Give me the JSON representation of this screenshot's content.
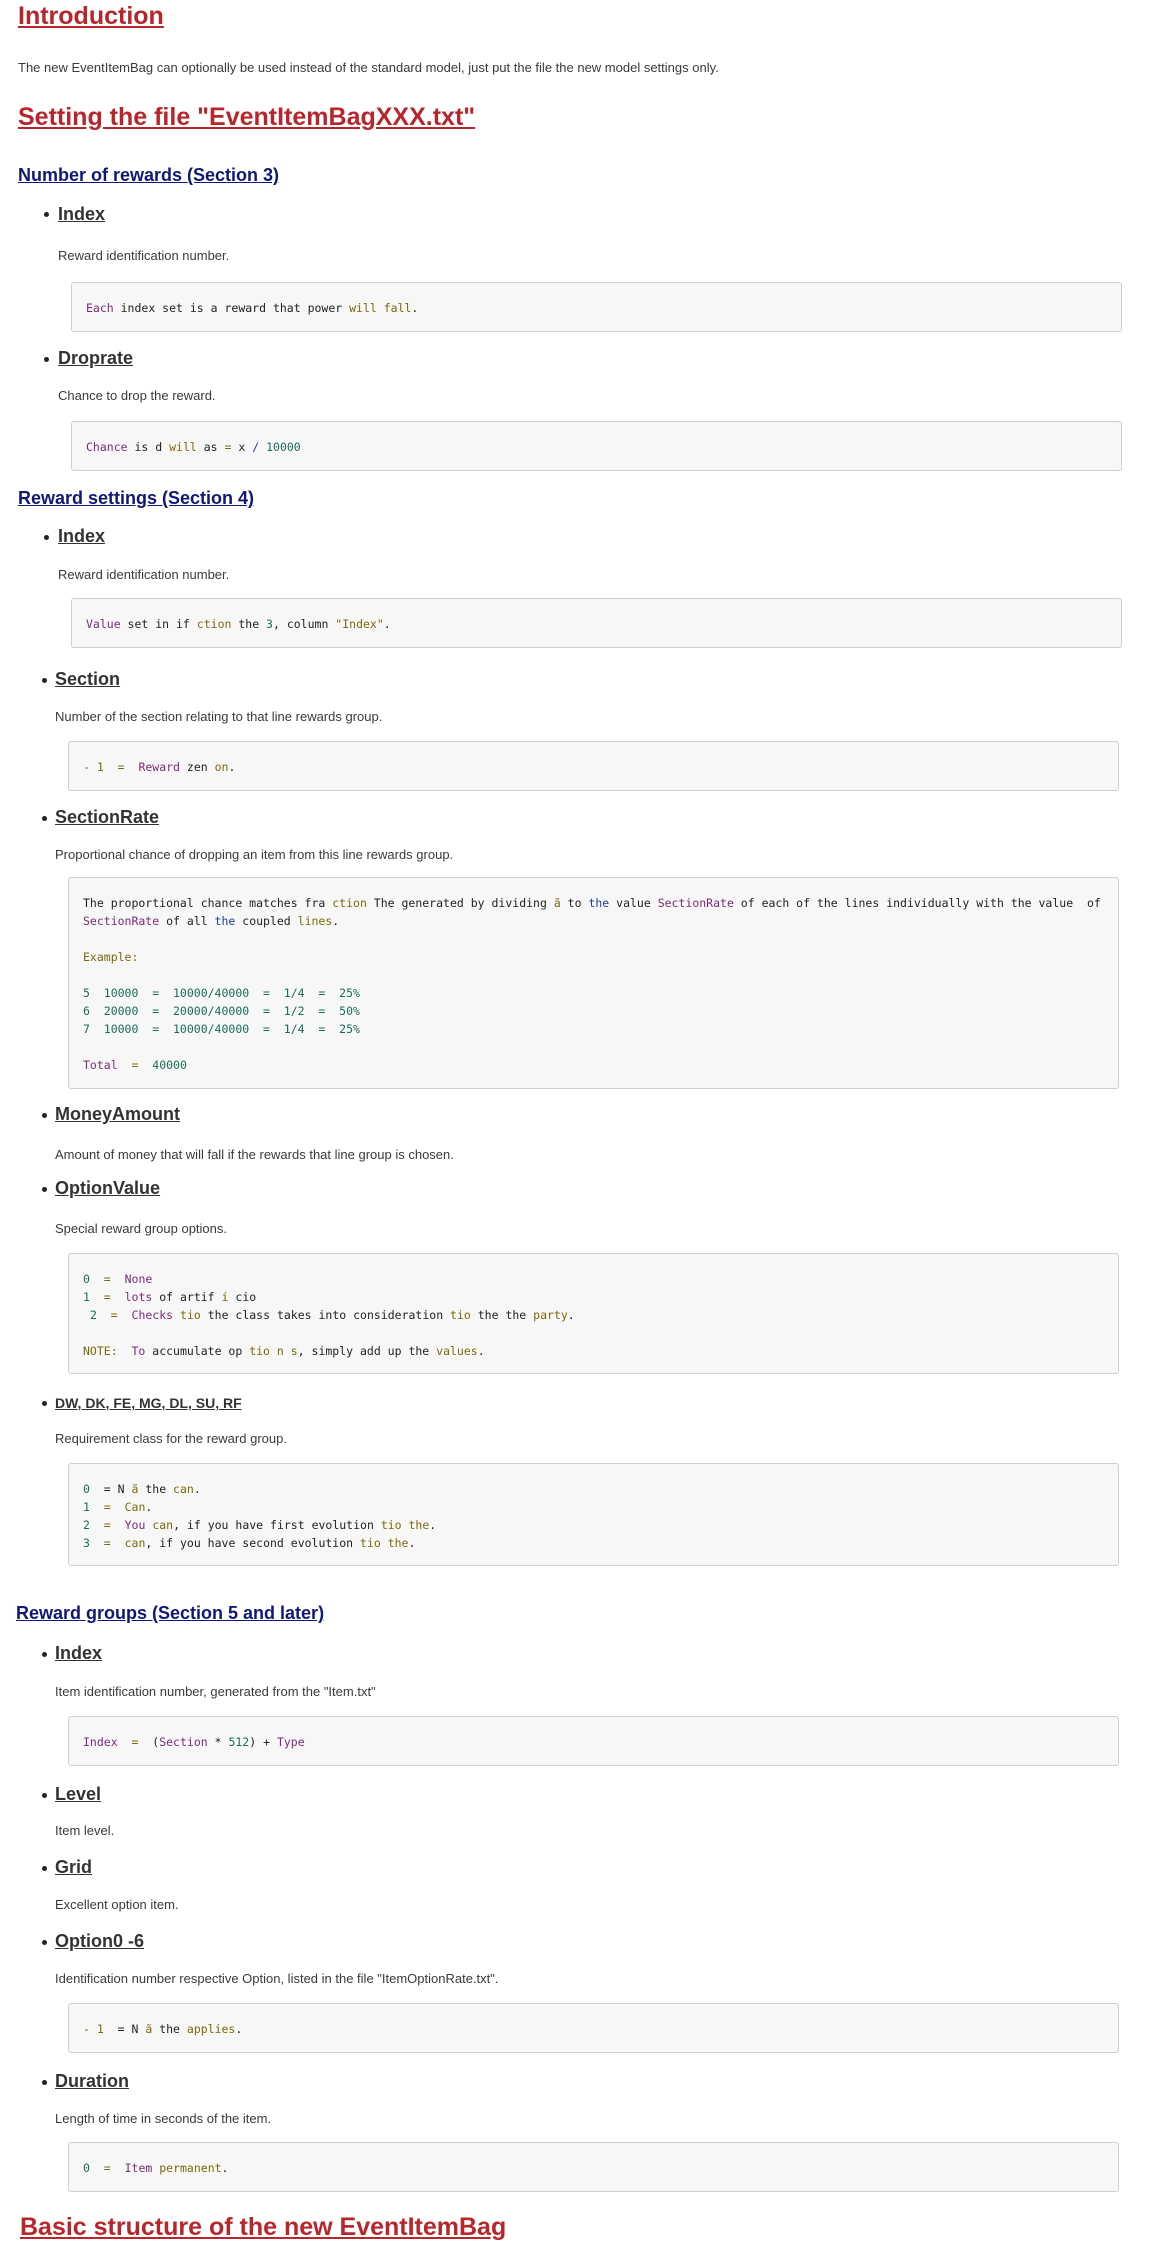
{
  "sections": {
    "introduction": {
      "title": "Introduction",
      "text": "The new EventItemBag can optionally be used instead of the standard model, just put the file the new model settings only."
    },
    "setting_file": {
      "title": "Setting the file \"EventItemBagXXX.txt\""
    },
    "number_of_rewards": {
      "title": "Number of rewards (Section 3)",
      "items": [
        {
          "name": "Index",
          "desc": "Reward identification number.",
          "code": [
            "Each index set is a reward that power will fall."
          ]
        },
        {
          "name": "Droprate",
          "desc": "Chance to drop the reward.",
          "code": [
            "Chance is d will as = x / 10000"
          ]
        }
      ]
    },
    "reward_settings": {
      "title": "Reward settings (Section 4)",
      "items": [
        {
          "name": "Index",
          "desc": "Reward identification number.",
          "code": [
            "Value set in if ction the 3, column \"Index\"."
          ]
        },
        {
          "name": "Section",
          "desc": "Number of the section relating to that line rewards group.",
          "code": [
            "- 1  =  Reward zen on."
          ]
        },
        {
          "name": "SectionRate",
          "desc": "Proportional chance of dropping an item from  this line rewards group.",
          "code": [
            "The proportional chance matches fra ction The generated by dividing ã to the value SectionRate of each of the lines individually with the value  of SectionRate of all the coupled lines.",
            "",
            "Example:",
            "",
            "5  10000  =  10000/40000  =  1/4  =  25%",
            "6  20000  =  20000/40000  =  1/2  =  50%",
            "7  10000  =  10000/40000  =  1/4  =  25%",
            "",
            "Total  =  40000"
          ]
        },
        {
          "name": "MoneyAmount",
          "desc": "Amount of money that will fall  if the rewards that line group is chosen."
        },
        {
          "name": "OptionValue",
          "desc": "Special reward group options.",
          "code": [
            "0  =  None",
            "1  =  lots of artif í cio",
            " 2  =  Checks tio the class takes into consideration tio the the party.",
            "",
            "NOTE:  To accumulate op tio n s, simply add up the values."
          ]
        },
        {
          "name": "DW, DK, FE, MG, DL, SU, RF",
          "desc": "Requirement class for the reward group.",
          "code": [
            "0  = N ã the can.",
            "1  =  Can.",
            "2  =  You can, if you have first evolution tio the.",
            "3  =  can, if you have second evolution tio the."
          ]
        }
      ]
    },
    "reward_groups": {
      "title": "Reward groups (Section 5 and later)",
      "items": [
        {
          "name": "Index",
          "desc": "Item identification number, generated from the \"Item.txt\"",
          "code": [
            "Index  =  (Section * 512) + Type"
          ]
        },
        {
          "name": "Level",
          "desc": "Item level."
        },
        {
          "name": "Grid",
          "desc": "Excellent option item."
        },
        {
          "name": "Option0 -6",
          "desc": "Identification number respective Option, listed in the file \"ItemOptionRate.txt\".",
          "code": [
            "- 1  = N ã the applies."
          ]
        },
        {
          "name": "Duration",
          "desc": "Length of time in seconds of the item.",
          "code": [
            "0  =  Item permanent."
          ]
        }
      ]
    },
    "basic_structure": {
      "title": "Basic structure of the new EventItemBag"
    }
  },
  "colors": {
    "heading_red": "#b8262b",
    "heading_navy": "#101877",
    "code_bg": "#f7f7f7",
    "code_border": "#cfcfcf"
  }
}
